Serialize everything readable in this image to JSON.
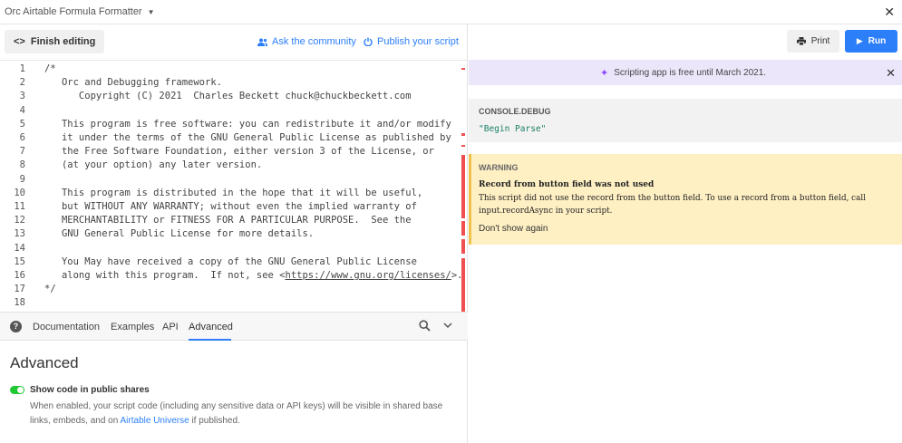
{
  "app": {
    "title": "Orc Airtable Formula Formatter",
    "close_glyph": "✕"
  },
  "toolbar": {
    "finish_label": "Finish editing",
    "community_label": "Ask the community",
    "publish_label": "Publish your script"
  },
  "editor": {
    "lines": [
      {
        "n": "1",
        "text": "/*"
      },
      {
        "n": "2",
        "text": "   Orc and Debugging framework."
      },
      {
        "n": "3",
        "text": "      Copyright (C) 2021  Charles Beckett chuck@chuckbeckett.com"
      },
      {
        "n": "4",
        "text": ""
      },
      {
        "n": "5",
        "text": "   This program is free software: you can redistribute it and/or modify"
      },
      {
        "n": "6",
        "text": "   it under the terms of the GNU General Public License as published by"
      },
      {
        "n": "7",
        "text": "   the Free Software Foundation, either version 3 of the License, or"
      },
      {
        "n": "8",
        "text": "   (at your option) any later version."
      },
      {
        "n": "9",
        "text": ""
      },
      {
        "n": "10",
        "text": "   This program is distributed in the hope that it will be useful,"
      },
      {
        "n": "11",
        "text": "   but WITHOUT ANY WARRANTY; without even the implied warranty of"
      },
      {
        "n": "12",
        "text": "   MERCHANTABILITY or FITNESS FOR A PARTICULAR PURPOSE.  See the"
      },
      {
        "n": "13",
        "text": "   GNU General Public License for more details."
      },
      {
        "n": "14",
        "text": ""
      },
      {
        "n": "15",
        "text": "   You May have received a copy of the GNU General Public License"
      },
      {
        "n": "16",
        "text": "   along with this program.  If not, see <",
        "url": "https://www.gnu.org/licenses/",
        "tail": ">."
      },
      {
        "n": "17",
        "text": "*/"
      },
      {
        "n": "18",
        "text": ""
      }
    ]
  },
  "tabs": {
    "items": [
      "Documentation",
      "Examples",
      "API",
      "Advanced"
    ],
    "active": "Advanced"
  },
  "advanced": {
    "title": "Advanced",
    "toggle_label": "Show code in public shares",
    "toggle_on": true,
    "desc_pre": "When enabled, your script code (including any sensitive data or API keys) will be visible in shared base links, embeds, and on ",
    "desc_link": "Airtable Universe",
    "desc_post": " if published."
  },
  "output": {
    "print_label": "Print",
    "run_label": "Run",
    "banner_text": "Scripting app is free until March 2021.",
    "debug_header": "CONSOLE.DEBUG",
    "debug_value": "\"Begin Parse\"",
    "warning_header": "WARNING",
    "warning_title": "Record from button field was not used",
    "warning_message": "This script did not use the record from the button field. To use a record from a button field, call input.recordAsync in your script.",
    "warning_dismiss": "Don't show again"
  },
  "colors": {
    "accent": "#2d7ff9",
    "toggle_on": "#20c933",
    "error_mark": "#ef4f4f",
    "banner_bg": "#ece6fb",
    "warning_bg": "#fff0c4"
  }
}
